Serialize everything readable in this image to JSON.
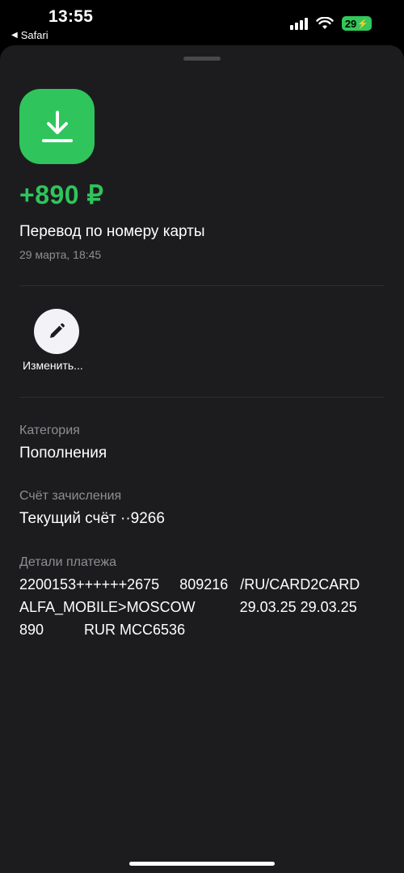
{
  "status_bar": {
    "time": "13:55",
    "back_app": "Safari",
    "battery": "29"
  },
  "transaction": {
    "amount": "+890 ₽",
    "title": "Перевод по номеру карты",
    "date": "29 марта, 18:45",
    "edit_label": "Изменить..."
  },
  "fields": {
    "category_label": "Категория",
    "category_value": "Пополнения",
    "account_label": "Счёт зачисления",
    "account_value": "Текущий счёт ··9266",
    "details_label": "Детали платежа",
    "details_lines": [
      "2200153++++++2675     809216   /RU/CARD2CARD",
      "ALFA_MOBILE>MOSCOW           29.03.25 29.03.25",
      "890          RUR MCC6536"
    ]
  },
  "colors": {
    "accent_green": "#2fc55c",
    "sheet_bg": "#1c1c1e",
    "secondary_text": "#8e8e93"
  },
  "icons": [
    "download-icon",
    "pencil-icon",
    "signal-icon",
    "wifi-icon",
    "battery-icon",
    "back-arrow-icon"
  ]
}
